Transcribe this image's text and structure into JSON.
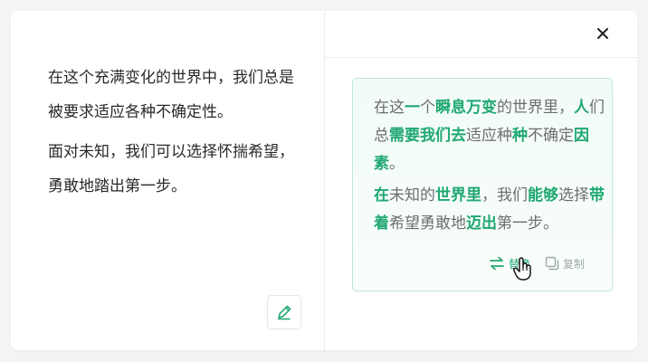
{
  "left": {
    "paragraphs": [
      "在这个充满变化的世界中，我们总是被要求适应各种不确定性。",
      "面对未知，我们可以选择怀揣希望，勇敢地踏出第一步。"
    ]
  },
  "result": {
    "paragraphs": [
      [
        {
          "t": "在这",
          "h": false
        },
        {
          "t": "一",
          "h": true
        },
        {
          "t": "个",
          "h": false
        },
        {
          "t": "瞬息万变",
          "h": true
        },
        {
          "t": "的世界里，",
          "h": false
        },
        {
          "t": "人",
          "h": true
        },
        {
          "t": "们总",
          "h": false
        },
        {
          "t": "需要",
          "h": true
        },
        {
          "t": "我们去",
          "h": true
        },
        {
          "t": "适应种",
          "h": false
        },
        {
          "t": "种",
          "h": true
        },
        {
          "t": "不确定",
          "h": false
        },
        {
          "t": "因素",
          "h": true
        },
        {
          "t": "。",
          "h": false
        }
      ],
      [
        {
          "t": "在",
          "h": true
        },
        {
          "t": "未知的",
          "h": false
        },
        {
          "t": "世界里",
          "h": true
        },
        {
          "t": "，我们",
          "h": false
        },
        {
          "t": "能够",
          "h": true
        },
        {
          "t": "选择",
          "h": false
        },
        {
          "t": "带着",
          "h": true
        },
        {
          "t": "希望勇敢地",
          "h": false
        },
        {
          "t": "迈出",
          "h": true
        },
        {
          "t": "第一步。",
          "h": false
        }
      ]
    ]
  },
  "actions": {
    "replace_label": "替换",
    "copy_label": "复制"
  },
  "icons": {
    "edit": "pencil-icon",
    "close": "close-icon",
    "replace": "swap-arrows-icon",
    "copy": "copy-icon"
  },
  "colors": {
    "accent": "#20a872",
    "result_border": "#bfe6d6",
    "result_bg": "#f1fbf7",
    "text": "#2a2a2a",
    "muted": "#6e6e6e"
  }
}
